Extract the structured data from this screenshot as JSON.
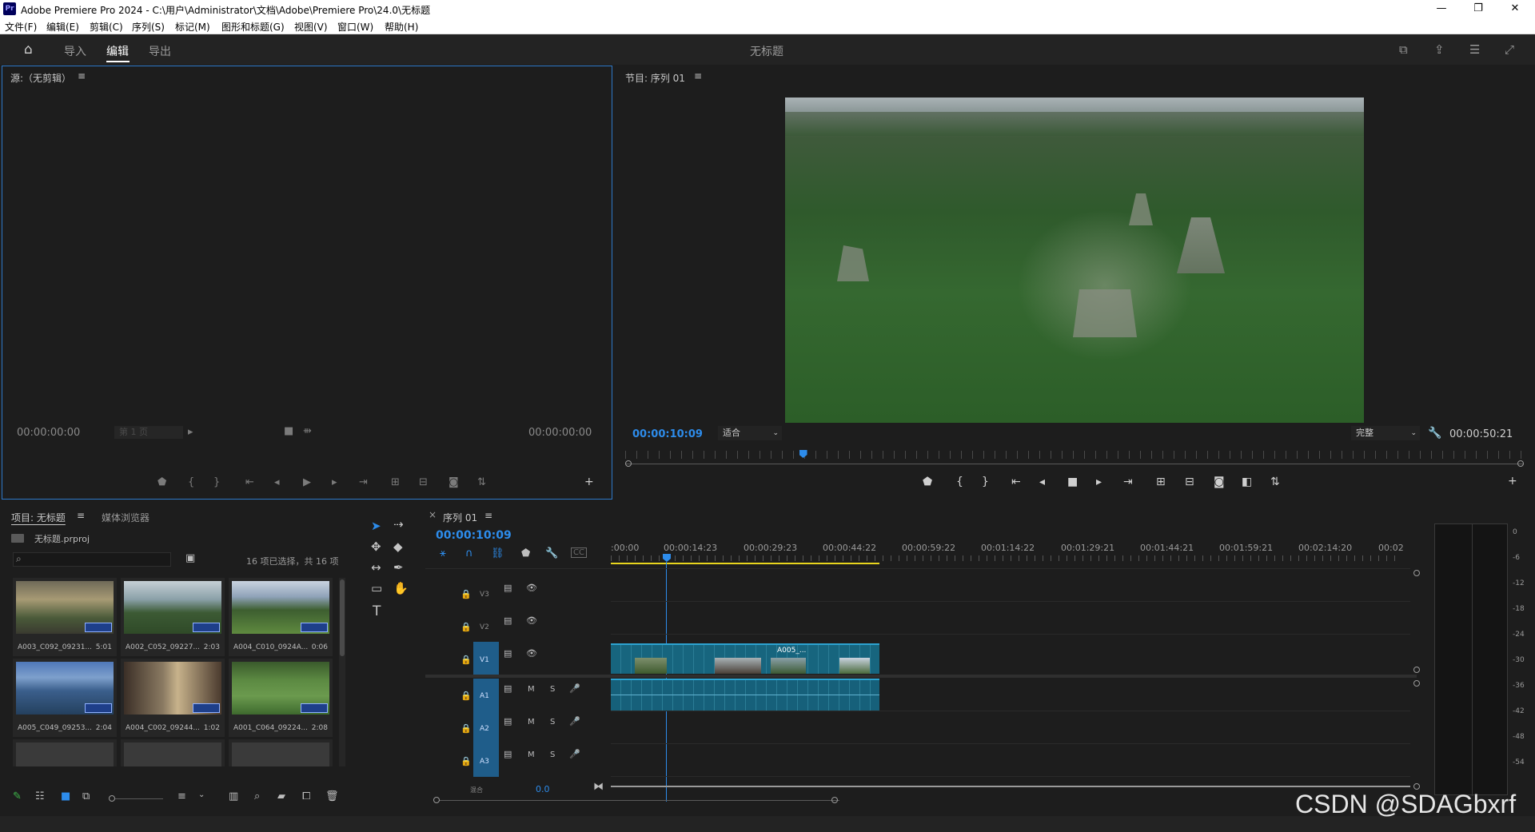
{
  "window": {
    "title": "Adobe Premiere Pro 2024 - C:\\用户\\Administrator\\文档\\Adobe\\Premiere Pro\\24.0\\无标题",
    "logo_text": "Pr",
    "minimize": "—",
    "maximize": "❐",
    "close": "✕"
  },
  "menu": [
    "文件(F)",
    "编辑(E)",
    "剪辑(C)",
    "序列(S)",
    "标记(M)",
    "图形和标题(G)",
    "视图(V)",
    "窗口(W)",
    "帮助(H)"
  ],
  "header": {
    "tabs": [
      "导入",
      "编辑",
      "导出"
    ],
    "active_tab": "编辑",
    "project_title": "无标题"
  },
  "source_monitor": {
    "title": "源:（无剪辑）",
    "timecode_in": "00:00:00:00",
    "timecode_out": "00:00:00:00",
    "page_select": "第 1 页"
  },
  "program_monitor": {
    "title": "节目: 序列 01",
    "timecode": "00:00:10:09",
    "fit_select": "适合",
    "quality_select": "完整",
    "duration": "00:00:50:21",
    "playhead_fraction": 0.198
  },
  "project": {
    "tabs": [
      "项目: 无标题",
      "媒体浏览器"
    ],
    "file_name": "无标题.prproj",
    "search_placeholder": "",
    "selection_status": "16 项已选择，共 16 项",
    "items": [
      {
        "name": "A003_C092_09231...",
        "duration": "5:01"
      },
      {
        "name": "A002_C052_09227...",
        "duration": "2:03"
      },
      {
        "name": "A004_C010_0924A...",
        "duration": "0:06"
      },
      {
        "name": "A005_C049_09253...",
        "duration": "2:04"
      },
      {
        "name": "A004_C002_09244...",
        "duration": "1:02"
      },
      {
        "name": "A001_C064_09224...",
        "duration": "2:08"
      }
    ]
  },
  "timeline": {
    "sequence_tab": "序列 01",
    "timecode": "00:00:10:09",
    "ruler_labels": [
      ":00:00",
      "00:00:14:23",
      "00:00:29:23",
      "00:00:44:22",
      "00:00:59:22",
      "00:01:14:22",
      "00:01:29:21",
      "00:01:44:21",
      "00:01:59:21",
      "00:02:14:20",
      "00:02"
    ],
    "video_tracks": [
      "V3",
      "V2",
      "V1"
    ],
    "audio_tracks": [
      "A1",
      "A2",
      "A3"
    ],
    "mute_label": "M",
    "solo_label": "S",
    "master_label": "混合",
    "master_value": "0.0",
    "clip_label": "A005_..."
  },
  "meter": {
    "scale": [
      "0",
      "-6",
      "-12",
      "-18",
      "-24",
      "-30",
      "-36",
      "-42",
      "-48",
      "-54"
    ]
  },
  "watermark": "CSDN @SDAGbxrf",
  "colors": {
    "accent": "#2d8ceb",
    "clip_video": "#17657e",
    "clip_audio": "#16607a",
    "work_area": "#e8d51e"
  }
}
